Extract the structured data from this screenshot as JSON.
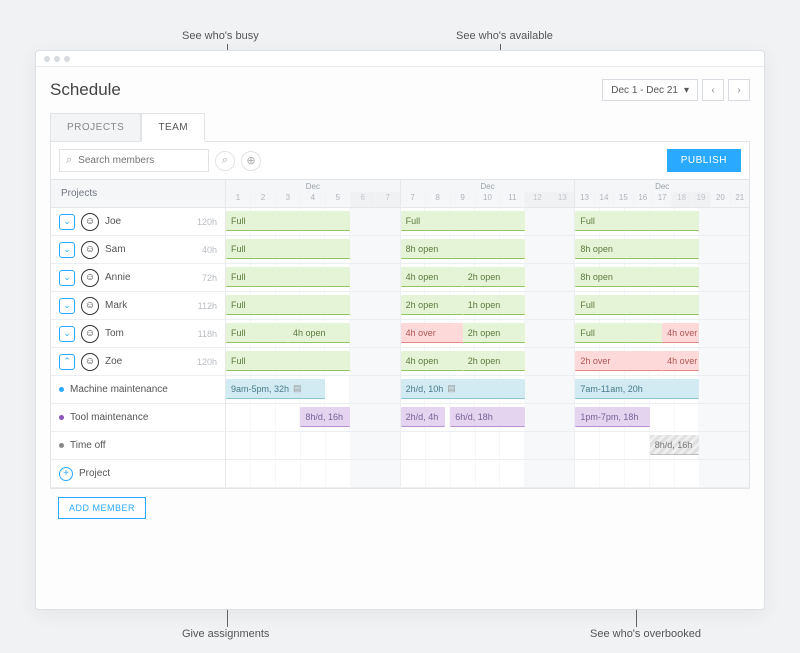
{
  "callouts": {
    "busy": "See who's busy",
    "available": "See who's available",
    "assignments": "Give assignments",
    "overbooked": "See who's overbooked"
  },
  "header": {
    "title": "Schedule",
    "range": "Dec 1 - Dec 21"
  },
  "tabs": {
    "projects": "PROJECTS",
    "team": "TEAM"
  },
  "toolbar": {
    "search_placeholder": "Search members",
    "publish": "PUBLISH"
  },
  "columns": {
    "projects": "Projects",
    "month": "Dec"
  },
  "days_header": [
    {
      "nums": [
        "1",
        "2",
        "3",
        "4",
        "5",
        "6",
        "7"
      ],
      "weekend": [
        5,
        6
      ]
    },
    {
      "nums": [
        "7",
        "8",
        "9",
        "10",
        "11",
        "12",
        "13"
      ],
      "weekend": [
        5,
        6
      ]
    },
    {
      "nums": [
        "13",
        "14",
        "15",
        "16",
        "17",
        "18",
        "19",
        "20",
        "21"
      ],
      "weekend": [
        5,
        6
      ]
    }
  ],
  "members": [
    {
      "name": "Joe",
      "hours": "120h",
      "expanded": false,
      "weeks": [
        [
          {
            "label": "Full",
            "type": "green",
            "start": 0,
            "end": 5
          }
        ],
        [
          {
            "label": "Full",
            "type": "green",
            "start": 0,
            "end": 5
          }
        ],
        [
          {
            "label": "Full",
            "type": "green",
            "start": 0,
            "end": 5
          }
        ]
      ]
    },
    {
      "name": "Sam",
      "hours": "40h",
      "expanded": false,
      "weeks": [
        [
          {
            "label": "Full",
            "type": "green",
            "start": 0,
            "end": 5
          }
        ],
        [
          {
            "label": "8h open",
            "type": "green",
            "start": 0,
            "end": 5
          }
        ],
        [
          {
            "label": "8h open",
            "type": "green",
            "start": 0,
            "end": 5
          }
        ]
      ]
    },
    {
      "name": "Annie",
      "hours": "72h",
      "expanded": false,
      "weeks": [
        [
          {
            "label": "Full",
            "type": "green",
            "start": 0,
            "end": 5
          }
        ],
        [
          {
            "label": "4h open",
            "type": "green",
            "start": 0,
            "end": 2.5
          },
          {
            "label": "2h open",
            "type": "green",
            "start": 2.5,
            "end": 5
          }
        ],
        [
          {
            "label": "8h open",
            "type": "green",
            "start": 0,
            "end": 5
          }
        ]
      ]
    },
    {
      "name": "Mark",
      "hours": "112h",
      "expanded": false,
      "weeks": [
        [
          {
            "label": "Full",
            "type": "green",
            "start": 0,
            "end": 5
          }
        ],
        [
          {
            "label": "2h open",
            "type": "green",
            "start": 0,
            "end": 2.5
          },
          {
            "label": "1h open",
            "type": "green",
            "start": 2.5,
            "end": 5
          }
        ],
        [
          {
            "label": "Full",
            "type": "green",
            "start": 0,
            "end": 5
          }
        ]
      ]
    },
    {
      "name": "Tom",
      "hours": "118h",
      "expanded": false,
      "weeks": [
        [
          {
            "label": "Full",
            "type": "green",
            "start": 0,
            "end": 2.5
          },
          {
            "label": "4h open",
            "type": "green",
            "start": 2.5,
            "end": 5
          }
        ],
        [
          {
            "label": "4h over",
            "type": "red",
            "start": 0,
            "end": 2.5
          },
          {
            "label": "2h open",
            "type": "green",
            "start": 2.5,
            "end": 5
          }
        ],
        [
          {
            "label": "Full",
            "type": "green",
            "start": 0,
            "end": 3.5
          },
          {
            "label": "4h over",
            "type": "red",
            "start": 3.5,
            "end": 5
          }
        ]
      ]
    },
    {
      "name": "Zoe",
      "hours": "120h",
      "expanded": true,
      "weeks": [
        [
          {
            "label": "Full",
            "type": "green",
            "start": 0,
            "end": 5
          }
        ],
        [
          {
            "label": "4h open",
            "type": "green",
            "start": 0,
            "end": 2.5
          },
          {
            "label": "2h open",
            "type": "green",
            "start": 2.5,
            "end": 5
          }
        ],
        [
          {
            "label": "2h over",
            "type": "red",
            "start": 0,
            "end": 3.5
          },
          {
            "label": "4h over",
            "type": "red",
            "start": 3.5,
            "end": 5
          }
        ]
      ]
    }
  ],
  "projects": [
    {
      "name": "Machine maintenance",
      "color": "#29a9ff",
      "weeks": [
        [
          {
            "label": "9am-5pm, 32h",
            "note": true,
            "type": "blue",
            "start": 0,
            "end": 4
          }
        ],
        [
          {
            "label": "2h/d, 10h",
            "note": true,
            "type": "blue",
            "start": 0,
            "end": 5
          }
        ],
        [
          {
            "label": "7am-11am, 20h",
            "type": "blue",
            "start": 0,
            "end": 5
          }
        ]
      ]
    },
    {
      "name": "Tool maintenance",
      "color": "#8a54b8",
      "weeks": [
        [
          {
            "label": "8h/d, 16h",
            "type": "purple",
            "start": 3,
            "end": 5
          }
        ],
        [
          {
            "label": "2h/d, 4h",
            "type": "purple",
            "start": 0,
            "end": 1.8
          },
          {
            "label": "6h/d, 18h",
            "type": "purple",
            "start": 2,
            "end": 5
          }
        ],
        [
          {
            "label": "1pm-7pm, 18h",
            "type": "purple",
            "start": 0,
            "end": 3
          }
        ]
      ]
    },
    {
      "name": "Time off",
      "color": "#888",
      "weeks": [
        [],
        [],
        [
          {
            "label": "8h/d, 16h",
            "type": "hatch",
            "start": 3,
            "end": 5
          }
        ]
      ]
    }
  ],
  "add_project": "Project",
  "add_member": "ADD MEMBER"
}
